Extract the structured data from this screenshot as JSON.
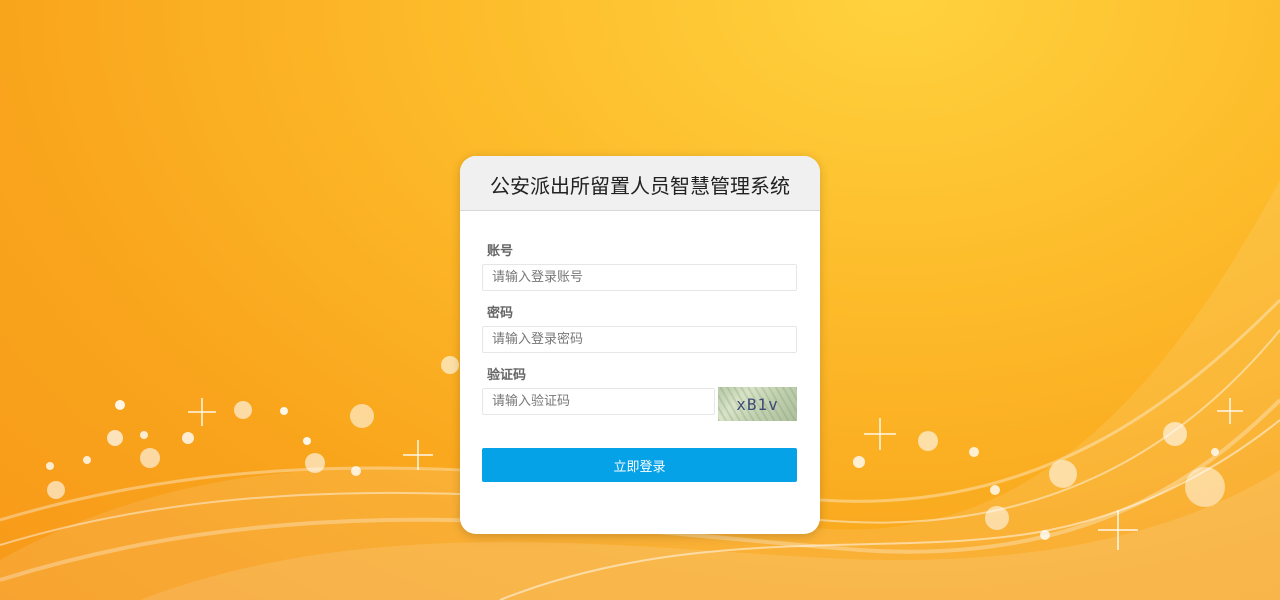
{
  "card": {
    "title": "公安派出所留置人员智慧管理系统"
  },
  "form": {
    "account": {
      "label": "账号",
      "placeholder": "请输入登录账号",
      "value": ""
    },
    "password": {
      "label": "密码",
      "placeholder": "请输入登录密码",
      "value": ""
    },
    "captcha": {
      "label": "验证码",
      "placeholder": "请输入验证码",
      "value": "",
      "image_text": "xB1v"
    },
    "submit_label": "立即登录"
  },
  "colors": {
    "background_orange": "#f9a51c",
    "button_blue": "#05a2e8",
    "header_gray": "#f0f0f0"
  }
}
